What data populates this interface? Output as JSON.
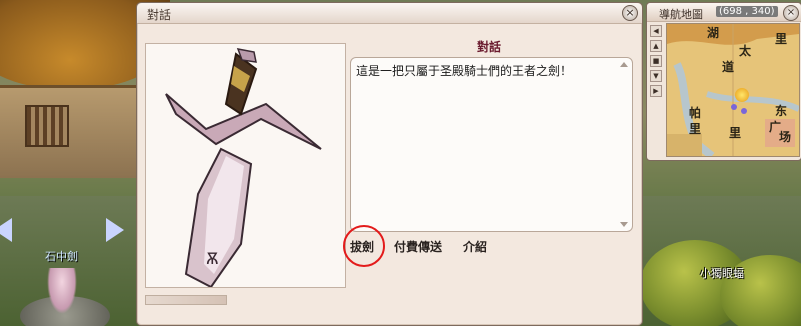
{
  "world": {
    "player_name": "石中劍",
    "monster_name": "小獨眼蝠"
  },
  "dialog": {
    "title": "對話",
    "close_icon": "×",
    "npc_title": "對話",
    "message": "這是一把只屬于圣殿騎士們的王者之劍！",
    "options": [
      {
        "label": "拔劍"
      },
      {
        "label": "付費傳送"
      },
      {
        "label": "介紹"
      }
    ],
    "highlight_color": "#e31b1b"
  },
  "minimap": {
    "title": "導航地圖",
    "coords": "(698 , 340)",
    "close_icon": "×",
    "side_buttons": [
      "◀",
      "▲",
      "■",
      "▼",
      "▶"
    ],
    "labels": [
      "湖",
      "太",
      "里",
      "道",
      "东",
      "广",
      "场",
      "帕",
      "里",
      "里"
    ]
  }
}
